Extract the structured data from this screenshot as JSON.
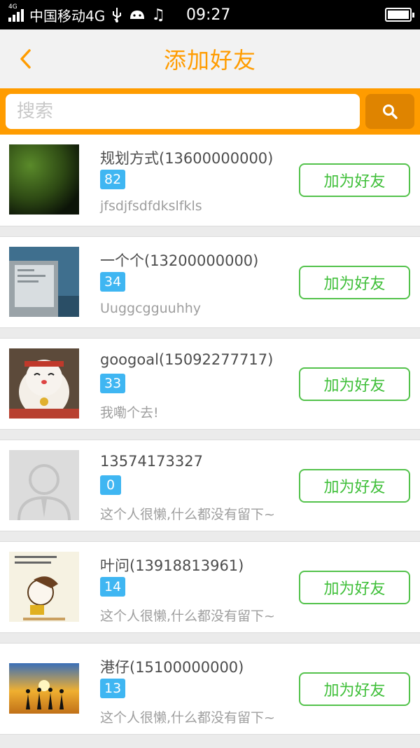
{
  "status_bar": {
    "network_tag": "4G",
    "carrier": "中国移动4G",
    "time": "09:27"
  },
  "header": {
    "title": "添加好友",
    "back_icon": "chevron-left-icon"
  },
  "search": {
    "placeholder": "搜索",
    "value": "",
    "button_icon": "search-icon"
  },
  "colors": {
    "accent": "#ff9c00",
    "badge": "#3fb6f2",
    "add_button": "#53c24b"
  },
  "friends": [
    {
      "name": "规划方式(13600000000)",
      "level": "82",
      "signature": "jfsdjfsdfdkslfkls",
      "button": "加为好友"
    },
    {
      "name": "一个个(13200000000)",
      "level": "34",
      "signature": "Uuggcgguuhhy",
      "button": "加为好友"
    },
    {
      "name": "googoal(15092277717)",
      "level": "33",
      "signature": "我嘞个去!",
      "button": "加为好友"
    },
    {
      "name": "13574173327",
      "level": "0",
      "signature": "这个人很懒,什么都没有留下~",
      "button": "加为好友"
    },
    {
      "name": "叶问(13918813961)",
      "level": "14",
      "signature": "这个人很懒,什么都没有留下~",
      "button": "加为好友"
    },
    {
      "name": "港仔(15100000000)",
      "level": "13",
      "signature": "这个人很懒,什么都没有留下~",
      "button": "加为好友"
    }
  ]
}
